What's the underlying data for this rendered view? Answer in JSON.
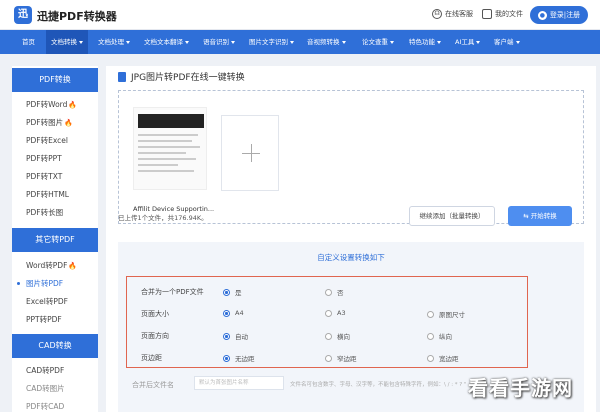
{
  "header": {
    "logo_text": "迅",
    "brand": "迅捷PDF转换器",
    "service": "在线客服",
    "my_files": "我的文件",
    "login": "登录|注册"
  },
  "nav": {
    "items": [
      {
        "label": "首页",
        "caret": false
      },
      {
        "label": "文档转换",
        "caret": true
      },
      {
        "label": "文档处理",
        "caret": true
      },
      {
        "label": "文档文本翻译",
        "caret": true
      },
      {
        "label": "语音识别",
        "caret": true
      },
      {
        "label": "图片文字识别",
        "caret": true
      },
      {
        "label": "音视频转换",
        "caret": true
      },
      {
        "label": "论文查重",
        "caret": true
      },
      {
        "label": "特色功能",
        "caret": true
      },
      {
        "label": "AI工具",
        "caret": true
      },
      {
        "label": "客户端",
        "caret": true
      }
    ]
  },
  "sidebar": {
    "groups": [
      {
        "title": "PDF转换",
        "items": [
          {
            "label": "PDF转Word",
            "hot": true
          },
          {
            "label": "PDF转图片",
            "hot": true
          },
          {
            "label": "PDF转Excel",
            "hot": false
          },
          {
            "label": "PDF转PPT",
            "hot": false
          },
          {
            "label": "PDF转TXT",
            "hot": false
          },
          {
            "label": "PDF转HTML",
            "hot": false
          },
          {
            "label": "PDF转长图",
            "hot": false
          }
        ]
      },
      {
        "title": "其它转PDF",
        "items": [
          {
            "label": "Word转PDF",
            "hot": true
          },
          {
            "label": "图片转PDF",
            "hot": false
          },
          {
            "label": "Excel转PDF",
            "hot": false
          },
          {
            "label": "PPT转PDF",
            "hot": false
          }
        ]
      },
      {
        "title": "CAD转换",
        "items": [
          {
            "label": "CAD转PDF",
            "hot": false
          },
          {
            "label": "CAD转图片",
            "hot": false
          },
          {
            "label": "PDF转CAD",
            "hot": false
          }
        ]
      }
    ],
    "hot_icon": "🔥"
  },
  "main": {
    "title": "JPG图片转PDF在线一键转换",
    "file_name": "Affilit Device Supportin...",
    "thumb_text": "My Sony Device Support Certificate Notification",
    "info": "已上传1个文件，共176.94K。",
    "add_more": "继续添加（批量转换）",
    "start": "开始转换"
  },
  "settings": {
    "title": "自定义设置转换如下",
    "rows": [
      {
        "label": "合并为一个PDF文件",
        "options": [
          "是",
          "否"
        ],
        "selected": 0
      },
      {
        "label": "页面大小",
        "options": [
          "A4",
          "A3",
          "原图尺寸"
        ],
        "selected": 0
      },
      {
        "label": "页面方向",
        "options": [
          "自动",
          "横向",
          "纵向"
        ],
        "selected": 0
      },
      {
        "label": "页边距",
        "options": [
          "无边距",
          "窄边距",
          "宽边距"
        ],
        "selected": 0
      }
    ],
    "merge_label": "合并后文件名",
    "merge_placeholder": "默认为首张图片名称",
    "merge_hint": "文件名可包含数字、字母、汉字等，不能包含特殊字符，例如：\\ / : * ? \" < > |"
  },
  "watermark": "看看手游网"
}
